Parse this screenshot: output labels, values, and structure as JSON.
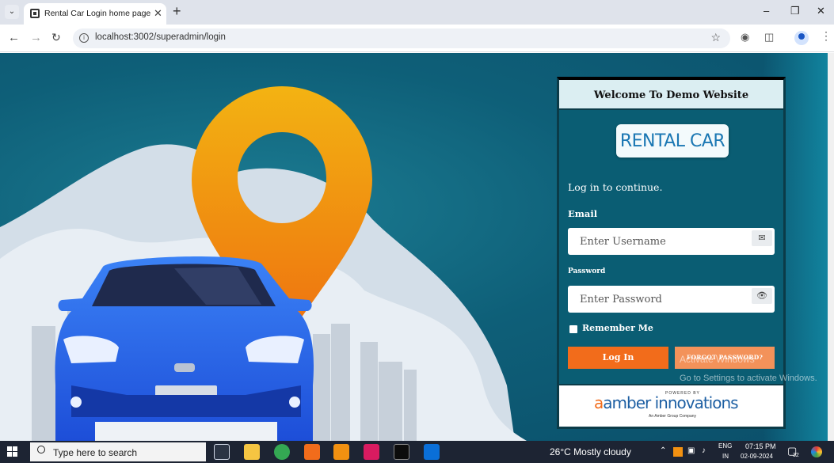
{
  "browser": {
    "tab_title": "Rental Car Login home page",
    "url": "localhost:3002/superadmin/login"
  },
  "login": {
    "welcome": "Welcome To Demo Website",
    "logo_text": "RENTAL CAR",
    "prompt": "Log in to continue.",
    "email_label": "Email",
    "email_placeholder": "Enter Username",
    "password_label": "Password",
    "password_placeholder": "Enter Password",
    "remember_label": "Remember Me",
    "login_button": "Log In",
    "forgot_button": "FORGOT PASSWORD?"
  },
  "footer": {
    "powered_by": "POWERED BY",
    "brand": "amber innovations",
    "brand_initial": "a",
    "brand_rest": "amber innovations",
    "brand_sub": "An Amber Group Company"
  },
  "watermark": {
    "line1": "Activate Windows",
    "line2": "Go to Settings to activate Windows."
  },
  "taskbar": {
    "search_placeholder": "Type here to search",
    "weather": "26°C  Mostly cloudy",
    "lang_top": "ENG",
    "lang_bottom": "IN",
    "time": "07:15 PM",
    "date": "02-09-2024",
    "notification_count": "32"
  },
  "colors": {
    "accent": "#f26c1b",
    "accent_light": "#f3925a",
    "card_bg": "#0a5d73",
    "pin_top": "#f3b312",
    "pin_bottom": "#ee7a0f",
    "car": "#1f5fe0"
  }
}
